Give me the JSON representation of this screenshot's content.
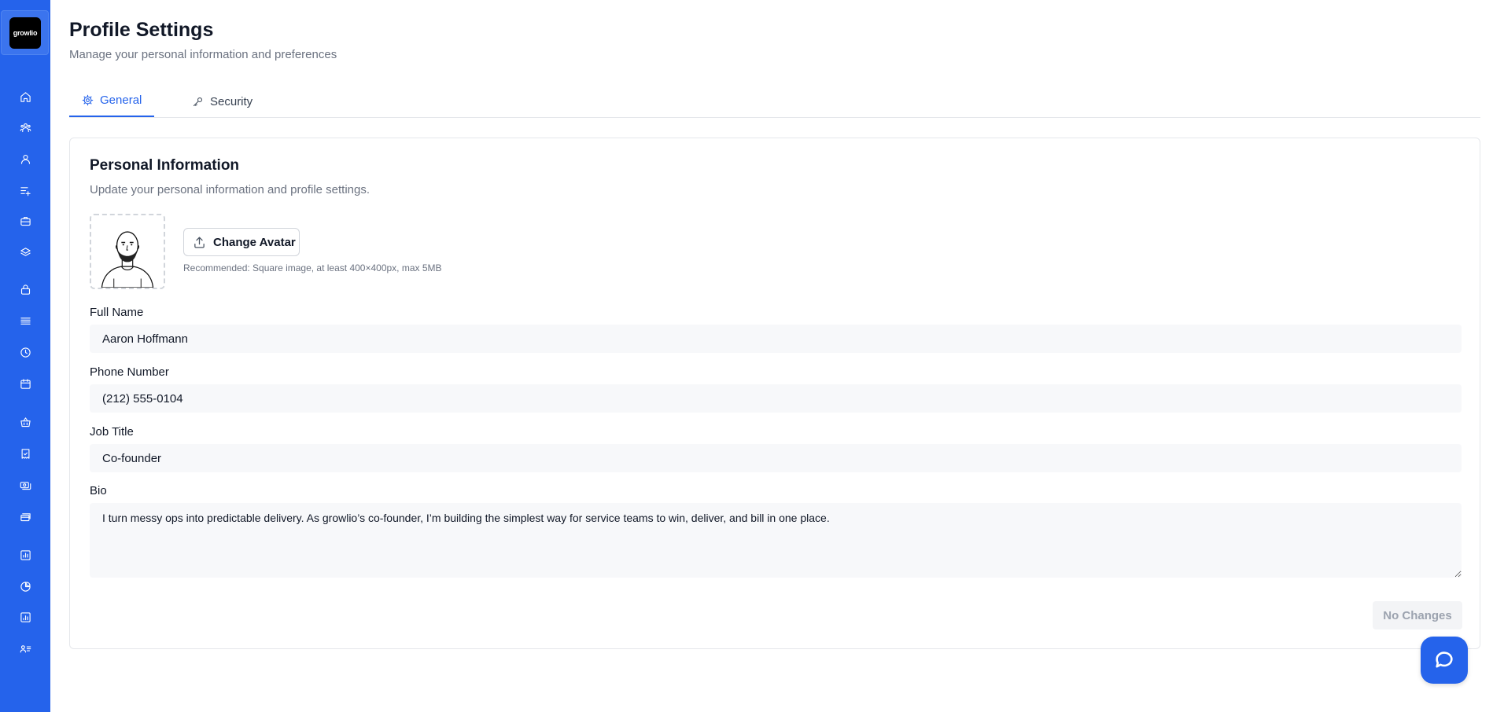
{
  "brand": {
    "logo_text": "growlio",
    "accent": "#2563eb"
  },
  "sidebar": {
    "items": [
      {
        "icon": "home-icon"
      },
      {
        "icon": "team-icon"
      },
      {
        "icon": "user-icon"
      },
      {
        "icon": "list-add-icon"
      },
      {
        "icon": "briefcase-icon"
      },
      {
        "icon": "layers-icon"
      },
      {
        "icon": "lock-icon"
      },
      {
        "icon": "menu-lines-icon"
      },
      {
        "icon": "clock-icon"
      },
      {
        "icon": "calendar-icon"
      },
      {
        "icon": "basket-icon"
      },
      {
        "icon": "receipt-icon"
      },
      {
        "icon": "money-icon"
      },
      {
        "icon": "cards-icon"
      },
      {
        "icon": "bar-chart-icon"
      },
      {
        "icon": "pie-chart-icon"
      },
      {
        "icon": "report-icon"
      },
      {
        "icon": "user-list-icon"
      }
    ]
  },
  "header": {
    "title": "Profile Settings",
    "subtitle": "Manage your personal information and preferences"
  },
  "tabs": [
    {
      "label": "General",
      "icon": "gear-icon",
      "active": true
    },
    {
      "label": "Security",
      "icon": "key-icon",
      "active": false
    }
  ],
  "personal_info": {
    "title": "Personal Information",
    "description": "Update your personal information and profile settings.",
    "change_avatar_label": "Change Avatar",
    "avatar_hint": "Recommended: Square image, at least 400×400px, max 5MB",
    "fields": {
      "full_name": {
        "label": "Full Name",
        "value": "Aaron Hoffmann"
      },
      "phone": {
        "label": "Phone Number",
        "value": "(212) 555-0104"
      },
      "job_title": {
        "label": "Job Title",
        "value": "Co-founder"
      },
      "bio": {
        "label": "Bio",
        "value": "I turn messy ops into predictable delivery. As growlio’s co-founder, I’m building the simplest way for service teams to win, deliver, and bill in one place."
      }
    },
    "save_label": "No Changes"
  }
}
